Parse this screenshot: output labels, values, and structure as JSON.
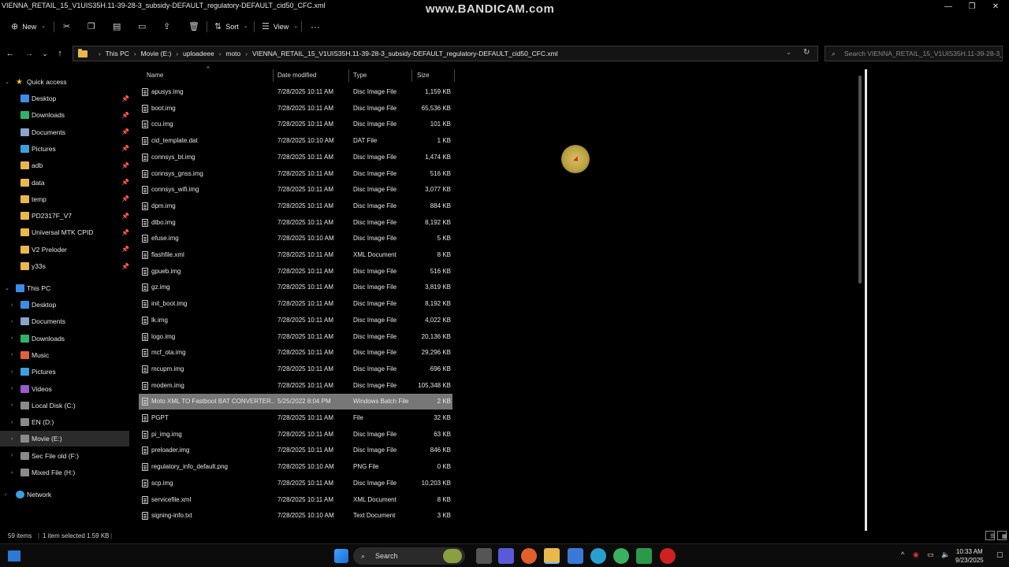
{
  "window": {
    "title": "VIENNA_RETAIL_15_V1UIS35H.11-39-28-3_subsidy-DEFAULT_regulatory-DEFAULT_cid50_CFC.xml",
    "watermark": "www.BANDICAM.com",
    "controls": [
      "—",
      "❐",
      "✕"
    ]
  },
  "toolbar": {
    "new_label": "New",
    "sort_label": "Sort",
    "view_label": "View",
    "more": "···"
  },
  "address": {
    "crumbs": [
      "This PC",
      "Movie (E:)",
      "uploadeee",
      "moto",
      "VIENNA_RETAIL_15_V1UIS35H.11-39-28-3_subsidy-DEFAULT_regulatory-DEFAULT_cid50_CFC.xml"
    ],
    "search_placeholder": "Search VIENNA_RETAIL_15_V1UIS35H.11-39-28-3_subsi..."
  },
  "nav": {
    "quick_access": "Quick access",
    "quick_items": [
      {
        "label": "Desktop",
        "icon": "desktop-icon",
        "color": "#3a8ee6"
      },
      {
        "label": "Downloads",
        "icon": "downloads-icon",
        "color": "#2fb36a"
      },
      {
        "label": "Documents",
        "icon": "documents-icon",
        "color": "#8aa4c8"
      },
      {
        "label": "Pictures",
        "icon": "pictures-icon",
        "color": "#3aa0e0"
      },
      {
        "label": "adb",
        "icon": "folder-icon",
        "color": "#e8b94a"
      },
      {
        "label": "data",
        "icon": "folder-icon",
        "color": "#e8b94a"
      },
      {
        "label": "temp",
        "icon": "folder-icon",
        "color": "#e8b94a"
      },
      {
        "label": "PD2317F_V7",
        "icon": "folder-icon",
        "color": "#e8b94a"
      },
      {
        "label": "Universal MTK CPID",
        "icon": "folder-icon",
        "color": "#e8b94a"
      },
      {
        "label": "V2 Preloder",
        "icon": "folder-icon",
        "color": "#e8b94a"
      },
      {
        "label": "y33s",
        "icon": "folder-icon",
        "color": "#e8b94a"
      }
    ],
    "this_pc": "This PC",
    "pc_items": [
      {
        "label": "Desktop",
        "icon": "desktop-icon",
        "color": "#3a8ee6"
      },
      {
        "label": "Documents",
        "icon": "documents-icon",
        "color": "#8aa4c8"
      },
      {
        "label": "Downloads",
        "icon": "downloads-icon",
        "color": "#2fb36a"
      },
      {
        "label": "Music",
        "icon": "music-icon",
        "color": "#e0603a"
      },
      {
        "label": "Pictures",
        "icon": "pictures-icon",
        "color": "#3aa0e0"
      },
      {
        "label": "Videos",
        "icon": "videos-icon",
        "color": "#9a5ad0"
      },
      {
        "label": "Local Disk (C:)",
        "icon": "drive-icon",
        "color": "#8a8a8a"
      },
      {
        "label": "EN (D:)",
        "icon": "drive-icon",
        "color": "#8a8a8a"
      },
      {
        "label": "Movie (E:)",
        "icon": "drive-icon",
        "color": "#8a8a8a"
      },
      {
        "label": "Sec  File old (F:)",
        "icon": "drive-icon",
        "color": "#8a8a8a"
      },
      {
        "label": "Mixed File  (H:)",
        "icon": "drive-icon",
        "color": "#8a8a8a"
      }
    ],
    "network": "Network"
  },
  "columns": {
    "name": "Name",
    "date": "Date modified",
    "type": "Type",
    "size": "Size"
  },
  "files": [
    {
      "name": "apusys.img",
      "date": "7/28/2025 10:11 AM",
      "type": "Disc Image File",
      "size": "1,159 KB"
    },
    {
      "name": "boot.img",
      "date": "7/28/2025 10:11 AM",
      "type": "Disc Image File",
      "size": "65,536 KB"
    },
    {
      "name": "ccu.img",
      "date": "7/28/2025 10:11 AM",
      "type": "Disc Image File",
      "size": "101 KB"
    },
    {
      "name": "cid_template.dat",
      "date": "7/28/2025 10:10 AM",
      "type": "DAT File",
      "size": "1 KB"
    },
    {
      "name": "connsys_bt.img",
      "date": "7/28/2025 10:11 AM",
      "type": "Disc Image File",
      "size": "1,474 KB"
    },
    {
      "name": "connsys_gnss.img",
      "date": "7/28/2025 10:11 AM",
      "type": "Disc Image File",
      "size": "516 KB"
    },
    {
      "name": "connsys_wifi.img",
      "date": "7/28/2025 10:11 AM",
      "type": "Disc Image File",
      "size": "3,077 KB"
    },
    {
      "name": "dpm.img",
      "date": "7/28/2025 10:11 AM",
      "type": "Disc Image File",
      "size": "884 KB"
    },
    {
      "name": "dtbo.img",
      "date": "7/28/2025 10:11 AM",
      "type": "Disc Image File",
      "size": "8,192 KB"
    },
    {
      "name": "efuse.img",
      "date": "7/28/2025 10:10 AM",
      "type": "Disc Image File",
      "size": "5 KB"
    },
    {
      "name": "flashfile.xml",
      "date": "7/28/2025 10:11 AM",
      "type": "XML Document",
      "size": "8 KB"
    },
    {
      "name": "gpueb.img",
      "date": "7/28/2025 10:11 AM",
      "type": "Disc Image File",
      "size": "516 KB"
    },
    {
      "name": "gz.img",
      "date": "7/28/2025 10:11 AM",
      "type": "Disc Image File",
      "size": "3,819 KB"
    },
    {
      "name": "init_boot.img",
      "date": "7/28/2025 10:11 AM",
      "type": "Disc Image File",
      "size": "8,192 KB"
    },
    {
      "name": "lk.img",
      "date": "7/28/2025 10:11 AM",
      "type": "Disc Image File",
      "size": "4,022 KB"
    },
    {
      "name": "logo.img",
      "date": "7/28/2025 10:11 AM",
      "type": "Disc Image File",
      "size": "20,136 KB"
    },
    {
      "name": "mcf_ota.img",
      "date": "7/28/2025 10:11 AM",
      "type": "Disc Image File",
      "size": "29,296 KB"
    },
    {
      "name": "mcupm.img",
      "date": "7/28/2025 10:11 AM",
      "type": "Disc Image File",
      "size": "696 KB"
    },
    {
      "name": "modem.img",
      "date": "7/28/2025 10:11 AM",
      "type": "Disc Image File",
      "size": "105,348 KB"
    },
    {
      "name": "Moto XML TO Fastboot BAT CONVERTER....",
      "date": "5/25/2022 8:04 PM",
      "type": "Windows Batch File",
      "size": "2 KB",
      "selected": true
    },
    {
      "name": "PGPT",
      "date": "7/28/2025 10:11 AM",
      "type": "File",
      "size": "32 KB"
    },
    {
      "name": "pi_img.img",
      "date": "7/28/2025 10:11 AM",
      "type": "Disc Image File",
      "size": "63 KB"
    },
    {
      "name": "preloader.img",
      "date": "7/28/2025 10:11 AM",
      "type": "Disc Image File",
      "size": "846 KB"
    },
    {
      "name": "regulatory_info_default.png",
      "date": "7/28/2025 10:10 AM",
      "type": "PNG File",
      "size": "0 KB"
    },
    {
      "name": "scp.img",
      "date": "7/28/2025 10:11 AM",
      "type": "Disc Image File",
      "size": "10,203 KB"
    },
    {
      "name": "servicefile.xml",
      "date": "7/28/2025 10:11 AM",
      "type": "XML Document",
      "size": "8 KB"
    },
    {
      "name": "signing-info.txt",
      "date": "7/28/2025 10:10 AM",
      "type": "Text Document",
      "size": "3 KB"
    }
  ],
  "status": {
    "items": "59 items",
    "selected": "1 item selected  1.59 KB"
  },
  "taskbar": {
    "search_label": "Search",
    "time": "10:33 AM",
    "date": "9/23/2025"
  }
}
